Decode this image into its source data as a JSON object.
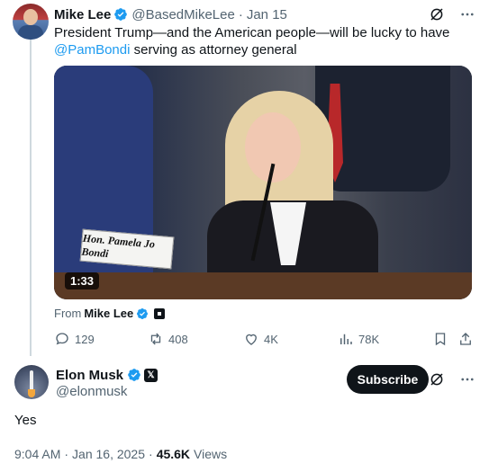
{
  "parent_tweet": {
    "author_name": "Mike Lee",
    "handle": "@BasedMikeLee",
    "separator": "·",
    "date": "Jan 15",
    "text_before": "President Trump—and the American people—will be lucky to have ",
    "mention": "@PamBondi",
    "text_after": " serving as attorney general",
    "video": {
      "duration": "1:33",
      "placard_text": "Hon. Pamela Jo Bondi"
    },
    "from_label": "From",
    "from_name": "Mike Lee",
    "actions": {
      "replies": "129",
      "reposts": "408",
      "likes": "4K",
      "views": "78K"
    },
    "icons": [
      "grok-icon",
      "more-icon",
      "reply-icon",
      "repost-icon",
      "like-icon",
      "views-icon",
      "bookmark-icon",
      "share-icon"
    ]
  },
  "main_tweet": {
    "author_name": "Elon Musk",
    "handle": "@elonmusk",
    "subscribe_label": "Subscribe",
    "text": "Yes",
    "time": "9:04 AM",
    "separator": "·",
    "date": "Jan 16, 2025",
    "separator2": "·",
    "views_count": "45.6K",
    "views_label": "Views",
    "badge_letter": "𝕏"
  },
  "colors": {
    "accent": "#1d9bf0",
    "text_primary": "#0f1419",
    "text_secondary": "#536471",
    "verified": "#1d9bf0"
  }
}
